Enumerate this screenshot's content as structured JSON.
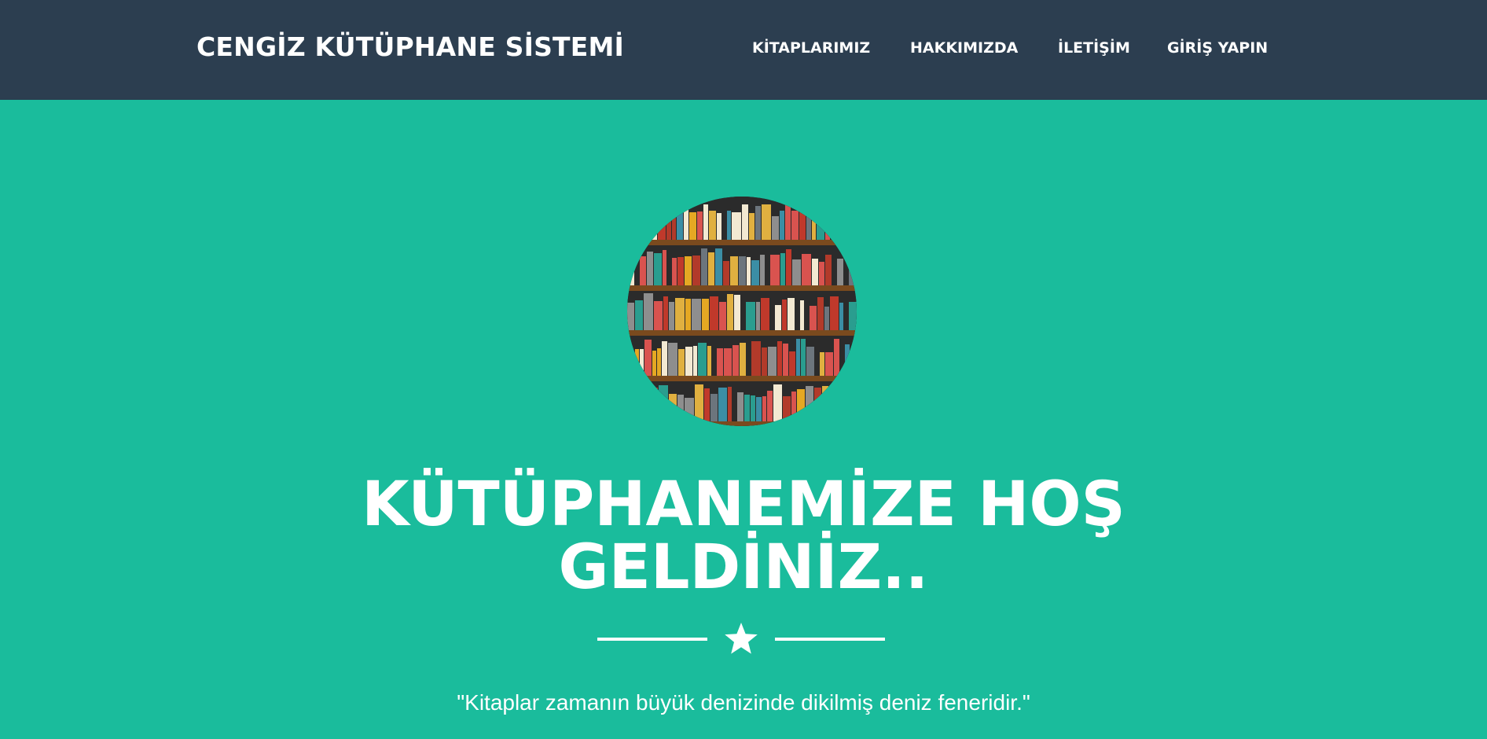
{
  "header": {
    "brand": "CENGİZ KÜTÜPHANE SİSTEMİ",
    "nav": [
      {
        "label": "KİTAPLARIMIZ"
      },
      {
        "label": "HAKKIMIZDA"
      },
      {
        "label": "İLETİŞİM"
      },
      {
        "label": "GİRİŞ YAPIN"
      }
    ]
  },
  "hero": {
    "image_icon": "bookshelf-image",
    "title": "KÜTÜPHANEMİZE HOŞ GELDİNİZ..",
    "divider_icon": "star-icon",
    "quote": "\"Kitaplar zamanın büyük denizinde dikilmiş deniz feneridir.\""
  },
  "colors": {
    "navbar_bg": "#2c3e50",
    "hero_bg": "#1abc9c",
    "text": "#ffffff"
  }
}
